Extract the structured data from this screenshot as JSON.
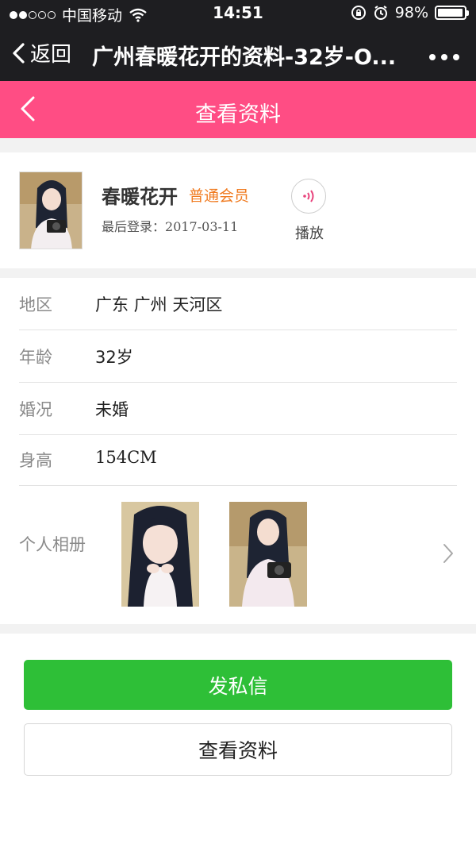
{
  "status_bar": {
    "carrier": "中国移动",
    "time": "14:51",
    "battery": "98%",
    "battery_level": 0.98
  },
  "nav": {
    "back_label": "返回",
    "title": "广州春暖花开的资料-32岁-O...",
    "more_icon": "more-dots-icon"
  },
  "header": {
    "title": "查看资料"
  },
  "profile": {
    "name": "春暖花开",
    "member_type": "普通会员",
    "last_login_label": "最后登录：",
    "last_login_date": "2017-03-11",
    "play_label": "播放",
    "accent": "#f07a1f"
  },
  "info_rows": [
    {
      "label": "地区",
      "value": "广东 广州 天河区"
    },
    {
      "label": "年龄",
      "value": "32岁"
    },
    {
      "label": "婚况",
      "value": "未婚"
    },
    {
      "label": "身高",
      "value": "154CM"
    }
  ],
  "album": {
    "label": "个人相册"
  },
  "buttons": {
    "message": "发私信",
    "view_profile": "查看资料"
  },
  "colors": {
    "nav_bg": "#1e1e21",
    "header_pink": "#ff4d84",
    "primary_green": "#2ebf37"
  }
}
